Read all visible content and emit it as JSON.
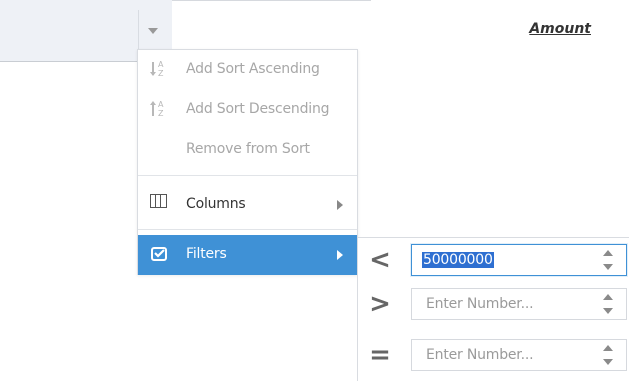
{
  "grid": {
    "column_header": {
      "label": "Amount"
    }
  },
  "menu": {
    "items": [
      {
        "label": "Add Sort Ascending",
        "state": "disabled"
      },
      {
        "label": "Add Sort Descending",
        "state": "disabled"
      },
      {
        "label": "Remove from Sort",
        "state": "disabled"
      },
      {
        "label": "Columns",
        "state": "normal"
      },
      {
        "label": "Filters",
        "state": "active"
      }
    ]
  },
  "filters": {
    "rows": [
      {
        "operator": "<",
        "value": "50000000",
        "placeholder": "Enter Number..."
      },
      {
        "operator": ">",
        "value": "",
        "placeholder": "Enter Number..."
      },
      {
        "operator": "=",
        "value": "",
        "placeholder": "Enter Number..."
      }
    ]
  },
  "theme": {
    "accent": "#3f91d6",
    "selection": "#2e6fd1"
  }
}
